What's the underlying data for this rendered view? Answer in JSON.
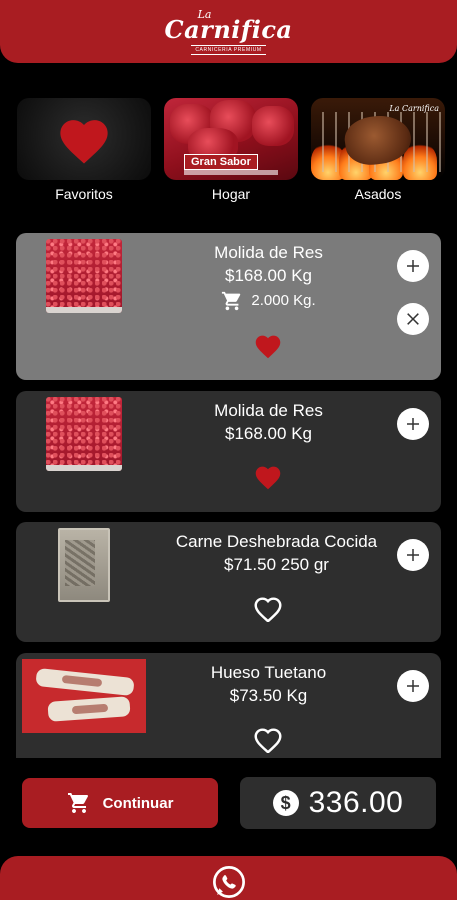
{
  "brand": {
    "top": "La",
    "name": "Carnifica",
    "tagline": "CARNICERIA PREMIUM"
  },
  "categories": [
    {
      "label": "Favoritos",
      "icon": "heart-icon"
    },
    {
      "label": "Hogar",
      "badge": "Gran Sabor",
      "icon": "meat-photo"
    },
    {
      "label": "Asados",
      "logo": "La Carnifica",
      "icon": "grill-photo"
    }
  ],
  "products": [
    {
      "name": "Molida de Res",
      "price": "$168.00 Kg",
      "cart_qty": "2.000 Kg.",
      "favorite": true,
      "selected": true
    },
    {
      "name": "Molida de Res",
      "price": "$168.00 Kg",
      "favorite": true,
      "selected": false
    },
    {
      "name": "Carne Deshebrada Cocida",
      "price": "$71.50 250 gr",
      "favorite": false,
      "selected": false
    },
    {
      "name": "Hueso Tuetano",
      "price": "$73.50 Kg",
      "favorite": false,
      "selected": false
    }
  ],
  "footer": {
    "continue_label": "Continuar",
    "total": "336.00",
    "currency_symbol": "$"
  },
  "colors": {
    "brand_red": "#a91d22",
    "heart_red": "#c0171d",
    "card_bg": "#2e2e2e",
    "card_selected_bg": "#7b7b7b"
  }
}
